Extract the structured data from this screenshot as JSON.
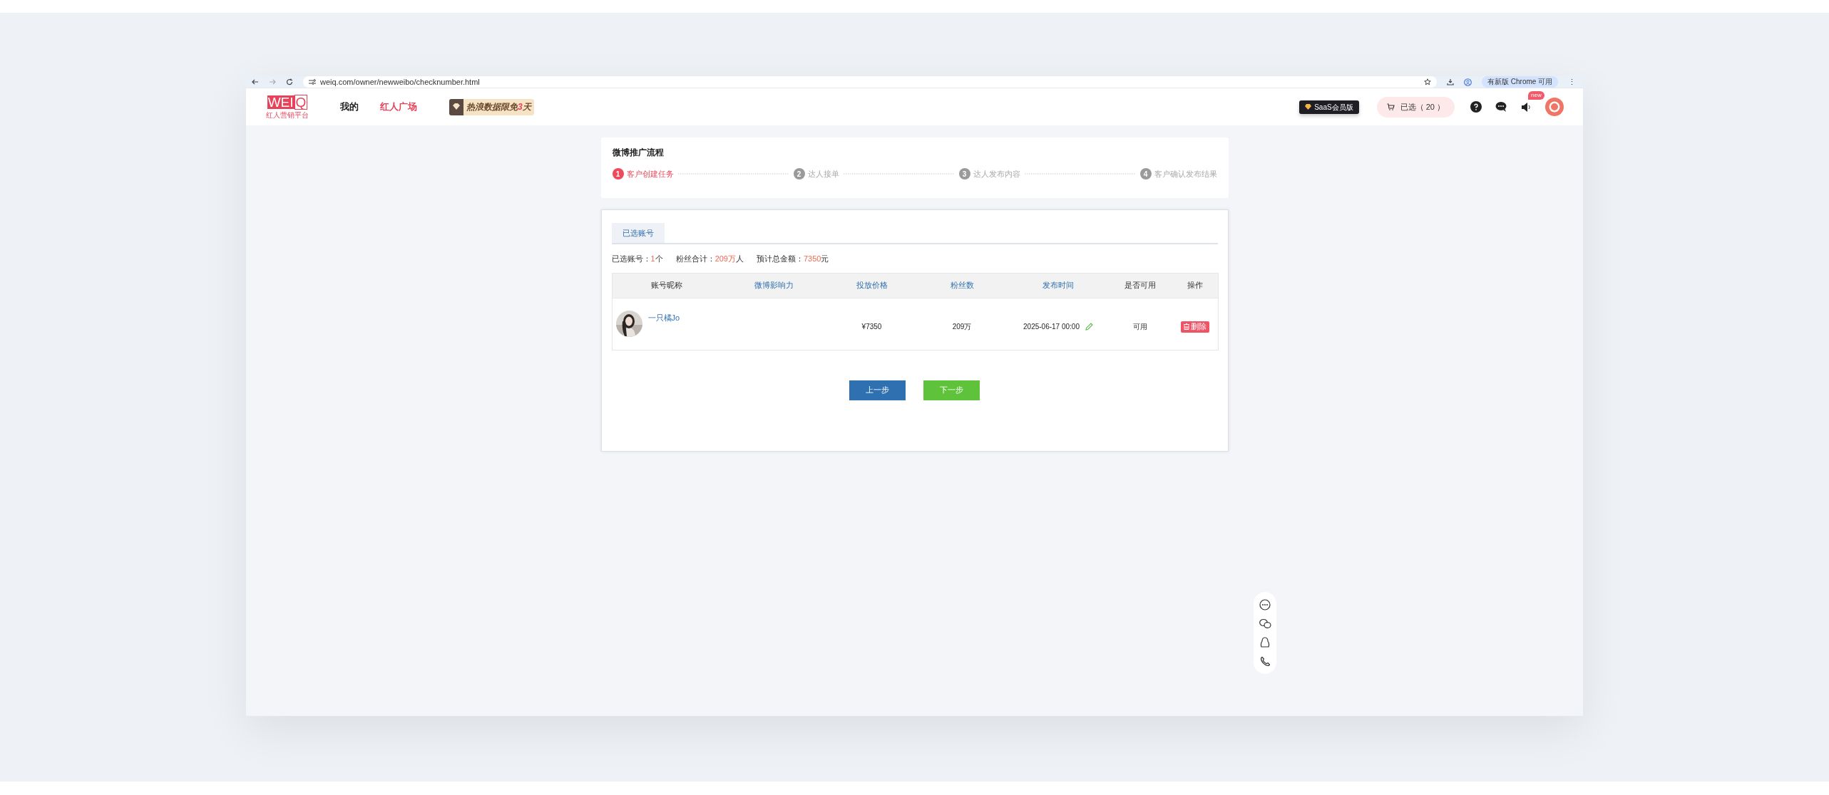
{
  "browser": {
    "url": "weiq.com/owner/newweibo/checknumber.html",
    "update_button": "有新版 Chrome 可用",
    "menu": "⋮"
  },
  "header": {
    "logo": {
      "boxed": "WEI",
      "plain": "Q",
      "tagline": "红人营销平台"
    },
    "nav": [
      {
        "label": "我的",
        "selected": false
      },
      {
        "label": "红人广场",
        "selected": true
      }
    ],
    "banner": {
      "parts": [
        {
          "text": "热浪数据限免",
          "highlight": false
        },
        {
          "text": "3",
          "highlight": true
        },
        {
          "text": "天",
          "highlight": false
        }
      ]
    },
    "saas_badge": "SaaS会员版",
    "cart": {
      "label": "已选（ 20 ）"
    },
    "notice_badge": "new"
  },
  "process": {
    "title": "微博推广流程",
    "steps": [
      {
        "number": "1",
        "label": "客户创建任务",
        "active": true
      },
      {
        "number": "2",
        "label": "达人接单",
        "active": false
      },
      {
        "number": "3",
        "label": "达人发布内容",
        "active": false
      },
      {
        "number": "4",
        "label": "客户确认发布结果",
        "active": false
      }
    ]
  },
  "tabs": [
    {
      "label": "已选账号",
      "selected": true
    }
  ],
  "summary": [
    {
      "parts": [
        {
          "text": "已选账号：",
          "highlight": false
        },
        {
          "text": "1",
          "highlight": true
        },
        {
          "text": "个",
          "highlight": false
        }
      ]
    },
    {
      "parts": [
        {
          "text": "粉丝合计：",
          "highlight": false
        },
        {
          "text": "209万",
          "highlight": true
        },
        {
          "text": "人",
          "highlight": false
        }
      ]
    },
    {
      "parts": [
        {
          "text": "预计总金额：",
          "highlight": false
        },
        {
          "text": "7350",
          "highlight": true
        },
        {
          "text": "元",
          "highlight": false
        }
      ]
    }
  ],
  "table": {
    "columns": [
      {
        "label": "账号昵称",
        "sortable": false
      },
      {
        "label": "微博影响力",
        "sortable": true
      },
      {
        "label": "投放价格",
        "sortable": true
      },
      {
        "label": "粉丝数",
        "sortable": true
      },
      {
        "label": "发布时间",
        "sortable": true
      },
      {
        "label": "是否可用",
        "sortable": false
      },
      {
        "label": "操作",
        "sortable": false
      }
    ],
    "rows": [
      {
        "name": "一只橘Jo",
        "price": "¥7350",
        "fans": "209万",
        "publish_time": "2025-06-17 00:00",
        "available": "可用",
        "action": "删除"
      }
    ]
  },
  "buttons": [
    {
      "label": "上一步",
      "kind": "prev"
    },
    {
      "label": "下一步",
      "kind": "next"
    }
  ]
}
